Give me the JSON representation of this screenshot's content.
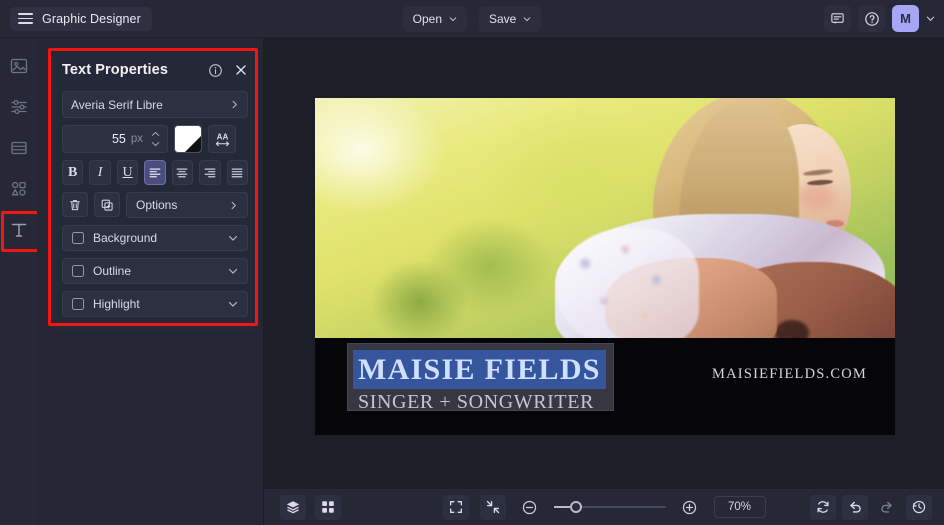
{
  "topbar": {
    "brand": "Graphic Designer",
    "menu_icon": "hamburger-icon",
    "open_label": "Open",
    "save_label": "Save",
    "comment_icon": "comment-icon",
    "help_icon": "help-circle-icon",
    "avatar_initial": "M",
    "avatar_caret_icon": "chevron-down-icon",
    "avatar_color": "#a5a6f6"
  },
  "sidebar": {
    "items": [
      {
        "name": "image-tool",
        "icon": "image-icon",
        "active": false
      },
      {
        "name": "adjustments-tool",
        "icon": "sliders-icon",
        "active": false
      },
      {
        "name": "layout-tool",
        "icon": "layout-rows-icon",
        "active": false
      },
      {
        "name": "shapes-tool",
        "icon": "shapes-icon",
        "active": false
      },
      {
        "name": "text-tool",
        "icon": "text-t-icon",
        "active": true
      }
    ],
    "highlight_color": "#f41414"
  },
  "panel": {
    "title": "Text Properties",
    "info_icon": "info-circle-icon",
    "close_icon": "close-x-icon",
    "font_family": "Averia Serif Libre",
    "font_chevron_icon": "chevron-right-icon",
    "font_size": "55",
    "font_size_unit": "px",
    "stepper_up_icon": "chevron-up-icon",
    "stepper_down_icon": "chevron-down-icon",
    "color_swatch": "#ffffff",
    "letter_spacing_icon": "letter-spacing-aa-icon",
    "bold_label": "B",
    "italic_label": "I",
    "underline_label": "U",
    "align_left_icon": "align-left-icon",
    "align_center_icon": "align-center-icon",
    "align_right_icon": "align-right-icon",
    "align_justify_icon": "align-justify-icon",
    "active_align": "left",
    "active_align_color": "#4b4d7e",
    "delete_icon": "trash-icon",
    "duplicate_icon": "duplicate-icon",
    "options_label": "Options",
    "options_chevron_icon": "chevron-right-icon",
    "toggles": [
      {
        "label": "Background",
        "checked": false,
        "chevron": "chevron-down-icon"
      },
      {
        "label": "Outline",
        "checked": false,
        "chevron": "chevron-down-icon"
      },
      {
        "label": "Highlight",
        "checked": false,
        "chevron": "chevron-down-icon"
      }
    ]
  },
  "canvas": {
    "artwork_alt": "watercolor-woman-with-guitar",
    "headline": "MAISIE FIELDS",
    "subhead": "SINGER + SONGWRITER",
    "website": "MAISIEFIELDS.COM",
    "selection_highlight_color": "#35559c",
    "headline_color": "#cfe0ff"
  },
  "bottombar": {
    "layers_icon": "layers-icon",
    "grid_icon": "grid-icon",
    "fit_screen_icon": "expand-frame-icon",
    "fit_content_icon": "collapse-arrows-icon",
    "zoom_out_icon": "minus-circle-icon",
    "zoom_in_icon": "plus-circle-icon",
    "zoom_level": "70%",
    "reset_icon": "refresh-icon",
    "undo_icon": "undo-arrow-icon",
    "redo_icon": "redo-arrow-icon",
    "history_icon": "history-clock-icon"
  }
}
